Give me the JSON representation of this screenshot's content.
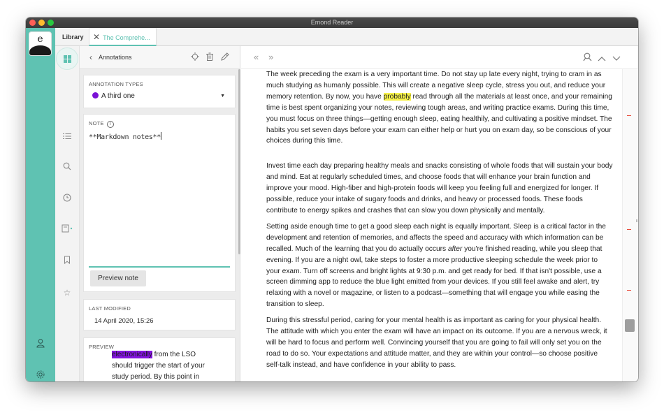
{
  "window": {
    "title": "Emond Reader"
  },
  "appbar": {
    "logo_letter": "e"
  },
  "tabs": {
    "library_label": "Library",
    "doc_label": "The Comprehe..."
  },
  "panel": {
    "header_title": "Annotations",
    "annotation_types": {
      "label": "ANNOTATION TYPES",
      "selected": "A third one",
      "dot_color": "#7a12d6"
    },
    "note": {
      "label": "NOTE",
      "value": "**Markdown notes**",
      "preview_button": "Preview note"
    },
    "last_modified": {
      "label": "LAST MODIFIED",
      "value": "14 April 2020, 15:26"
    },
    "preview": {
      "label": "PREVIEW",
      "highlight": "electronically",
      "text_line1": " from the LSO",
      "text_line2": "should trigger the start of your",
      "text_line3": "study period. By this point in"
    }
  },
  "reader": {
    "p1_before": "The week preceding the exam is a very important time. Do not stay up late every night, trying to cram in as much studying as humanly possible. This will create a negative sleep cycle, stress you out, and reduce your memory retention. By now, you have ",
    "p1_highlight": "probably",
    "p1_after": " read through all the materials at least once, and your remaining time is best spent organizing your notes, reviewing tough areas, and writing practice exams. During this time, you must focus on three things—getting enough sleep, eating healthily, and cultivating a positive mindset. The habits you set seven days before your exam can either help or hurt you on exam day, so be conscious of your choices during this time.",
    "p2": "Invest time each day preparing healthy meals and snacks consisting of whole foods that will sustain your body and mind. Eat at regularly scheduled times, and choose foods that will enhance your brain function and improve your mood. High-fiber and high-protein foods will keep you feeling full and energized for longer. If possible, reduce your intake of sugary foods and drinks, and heavy or processed foods. These foods contribute to energy spikes and crashes that can slow you down physically and mentally.",
    "p3_before": "Setting aside enough time to get a good sleep each night is equally important. Sleep is a critical factor in the development and retention of memories, and affects the speed and accuracy with which information can be recalled. Much of the learning that you do actually occurs ",
    "p3_italic": "after",
    "p3_after": " you're finished reading, while you sleep that evening. If you are a night owl, take steps to foster a more productive sleeping schedule the week prior to your exam. Turn off screens and bright lights at 9:30 p.m. and get ready for bed. If that isn't possible, use a screen dimming app to reduce the blue light emitted from your devices. If you still feel awake and alert, try relaxing with a novel or magazine, or listen to a podcast—something that will engage you while easing the transition to sleep.",
    "p4": "During this stressful period, caring for your mental health is as important as caring for your physical health. The attitude with which you enter the exam will have an impact on its outcome. If you are a nervous wreck, it will be hard to focus and perform well. Convincing yourself that you are going to fail will only set you on the road to do so. Your expectations and attitude matter, and they are within your control—so choose positive self-talk instead, and have confidence in your ability to pass."
  },
  "colors": {
    "accent": "#5fc2b2",
    "highlight_yellow": "#f7f24a",
    "highlight_purple": "#8414e0",
    "gutter_mark": "#e74c3c"
  }
}
